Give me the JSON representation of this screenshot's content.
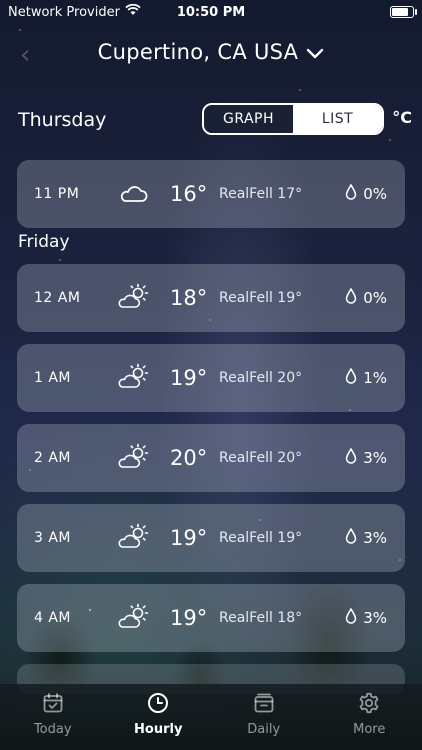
{
  "status": {
    "carrier": "Network Provider",
    "time": "10:50 PM",
    "battery_level": 0.9
  },
  "header": {
    "location": "Cupertino, CA USA"
  },
  "toolbar": {
    "day": "Thursday",
    "graph_label": "GRAPH",
    "list_label": "LIST",
    "selected_view": "list",
    "unit": "°C"
  },
  "thursday": [
    {
      "time": "11 PM",
      "icon": "cloudy-icon",
      "temp": "16°",
      "realfeel": "RealFell 17°",
      "precip": "0%"
    }
  ],
  "friday_label": "Friday",
  "friday": [
    {
      "time": "12 AM",
      "icon": "partly-sunny-icon",
      "temp": "18°",
      "realfeel": "RealFell 19°",
      "precip": "0%"
    },
    {
      "time": "1 AM",
      "icon": "partly-sunny-icon",
      "temp": "19°",
      "realfeel": "RealFell 20°",
      "precip": "1%"
    },
    {
      "time": "2 AM",
      "icon": "partly-sunny-icon",
      "temp": "20°",
      "realfeel": "RealFell 20°",
      "precip": "3%"
    },
    {
      "time": "3 AM",
      "icon": "partly-sunny-icon",
      "temp": "19°",
      "realfeel": "RealFell 19°",
      "precip": "3%"
    },
    {
      "time": "4 AM",
      "icon": "partly-sunny-icon",
      "temp": "19°",
      "realfeel": "RealFell 18°",
      "precip": "3%"
    }
  ],
  "tabs": [
    {
      "label": "Today",
      "icon": "calendar-check-icon",
      "active": false
    },
    {
      "label": "Hourly",
      "icon": "clock-icon",
      "active": true
    },
    {
      "label": "Daily",
      "icon": "calendar-icon",
      "active": false
    },
    {
      "label": "More",
      "icon": "gear-icon",
      "active": false
    }
  ]
}
